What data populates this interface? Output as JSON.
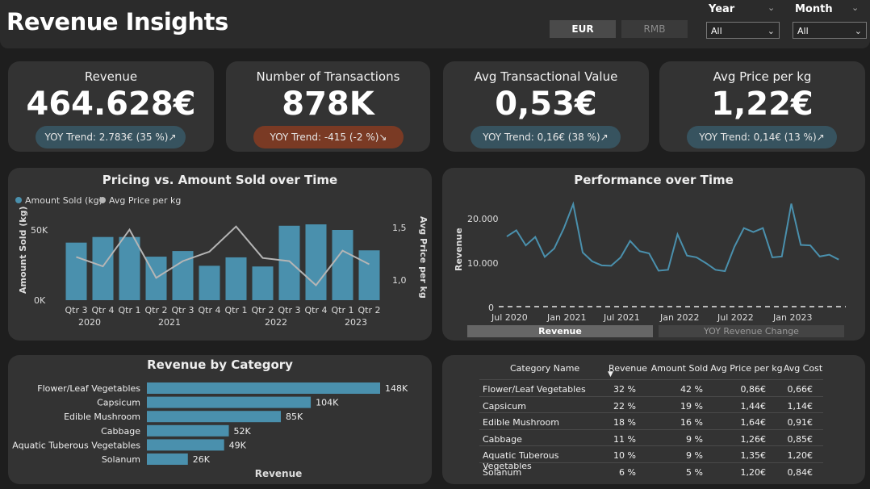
{
  "header": {
    "title": "Revenue Insights",
    "currency": {
      "eur": "EUR",
      "rmb": "RMB"
    },
    "year": {
      "label": "Year",
      "value": "All"
    },
    "month": {
      "label": "Month",
      "value": "All"
    }
  },
  "kpis": [
    {
      "title": "Revenue",
      "value": "464.628€",
      "trend": "YOY Trend: 2.783€ (35 %)↗",
      "direction": "up"
    },
    {
      "title": "Number of Transactions",
      "value": "878K",
      "trend": "YOY Trend: -415 (-2 %)↘",
      "direction": "down"
    },
    {
      "title": "Avg Transactional Value",
      "value": "0,53€",
      "trend": "YOY Trend: 0,16€ (38 %)↗",
      "direction": "up"
    },
    {
      "title": "Avg Price per kg",
      "value": "1,22€",
      "trend": "YOY Trend: 0,14€ (13 %)↗",
      "direction": "up"
    }
  ],
  "colors": {
    "accent": "#4a90ad",
    "line_gray": "#b5b5b5",
    "panel": "#333333",
    "background": "#1e1e1e"
  },
  "pricing_chart": {
    "title": "Pricing vs. Amount Sold over Time",
    "legend": [
      "Amount Sold (kg)",
      "Avg Price per kg"
    ],
    "ylabel_left": "Amount Sold (kg)",
    "ylabel_right": "Avg Price per kg",
    "left_ticks": [
      "50K",
      "0K"
    ],
    "right_ticks": [
      "1,5",
      "1,0"
    ],
    "quarters": [
      "Qtr 3",
      "Qtr 4",
      "Qtr 1",
      "Qtr 2",
      "Qtr 3",
      "Qtr 4",
      "Qtr 1",
      "Qtr 2",
      "Qtr 3",
      "Qtr 4",
      "Qtr 1",
      "Qtr 2"
    ],
    "years": [
      "2020",
      "2021",
      "2022",
      "2023"
    ]
  },
  "performance_chart": {
    "title": "Performance over Time",
    "ylabel": "Revenue",
    "y_ticks": [
      "20.000",
      "10.000",
      "0"
    ],
    "x_ticks": [
      "Jul 2020",
      "Jan 2021",
      "Jul 2021",
      "Jan 2022",
      "Jul 2022",
      "Jan 2023"
    ],
    "tab_active": "Revenue",
    "tab_inactive": "YOY Revenue Change"
  },
  "category_chart": {
    "title": "Revenue by Category",
    "xlabel": "Revenue",
    "value_labels": [
      "148K",
      "104K",
      "85K",
      "52K",
      "49K",
      "26K"
    ]
  },
  "table": {
    "headers": [
      "Category Name",
      "Revenue",
      "Amount Sold",
      "Avg Price per kg",
      "Avg Cost"
    ],
    "rows": [
      [
        "Flower/Leaf Vegetables",
        "32 %",
        "42 %",
        "0,86€",
        "0,66€"
      ],
      [
        "Capsicum",
        "22 %",
        "19 %",
        "1,44€",
        "1,14€"
      ],
      [
        "Edible Mushroom",
        "18 %",
        "16 %",
        "1,64€",
        "0,91€"
      ],
      [
        "Cabbage",
        "11 %",
        "9 %",
        "1,26€",
        "0,85€"
      ],
      [
        "Aquatic Tuberous Vegetables",
        "10 %",
        "9 %",
        "1,35€",
        "1,20€"
      ],
      [
        "Solanum",
        "6 %",
        "5 %",
        "1,20€",
        "0,84€"
      ]
    ]
  },
  "chart_data": [
    {
      "type": "bar",
      "title": "Pricing vs. Amount Sold over Time",
      "categories": [
        "2020 Qtr 3",
        "2020 Qtr 4",
        "2021 Qtr 1",
        "2021 Qtr 2",
        "2021 Qtr 3",
        "2021 Qtr 4",
        "2022 Qtr 1",
        "2022 Qtr 2",
        "2022 Qtr 3",
        "2022 Qtr 4",
        "2023 Qtr 1",
        "2023 Qtr 2"
      ],
      "series": [
        {
          "name": "Amount Sold (kg)",
          "type": "bar",
          "axis": "left",
          "values": [
            41000,
            45000,
            45000,
            31000,
            35000,
            24500,
            30500,
            24000,
            53000,
            54000,
            50000,
            35500
          ]
        },
        {
          "name": "Avg Price per kg",
          "type": "line",
          "axis": "right",
          "values": [
            1.22,
            1.13,
            1.48,
            1.02,
            1.18,
            1.27,
            1.51,
            1.21,
            1.18,
            0.95,
            1.28,
            1.15
          ]
        }
      ],
      "ylabel": "Amount Sold (kg)",
      "y2label": "Avg Price per kg",
      "ylim": [
        0,
        60000
      ],
      "y2lim": [
        0.8,
        1.7
      ],
      "legend": "top-left"
    },
    {
      "type": "line",
      "title": "Performance over Time",
      "x": [
        "2020-07",
        "2020-08",
        "2020-09",
        "2020-10",
        "2020-11",
        "2020-12",
        "2021-01",
        "2021-02",
        "2021-03",
        "2021-04",
        "2021-05",
        "2021-06",
        "2021-07",
        "2021-08",
        "2021-09",
        "2021-10",
        "2021-11",
        "2021-12",
        "2022-01",
        "2022-02",
        "2022-03",
        "2022-04",
        "2022-05",
        "2022-06",
        "2022-07",
        "2022-08",
        "2022-09",
        "2022-10",
        "2022-11",
        "2022-12",
        "2023-01",
        "2023-02",
        "2023-03",
        "2023-04",
        "2023-05",
        "2023-06"
      ],
      "series": [
        {
          "name": "Revenue",
          "values": [
            15800,
            17200,
            13800,
            15700,
            11200,
            13100,
            17600,
            23100,
            12200,
            10200,
            9300,
            9200,
            11100,
            14800,
            12500,
            12000,
            8100,
            8300,
            16300,
            11500,
            11100,
            9800,
            8300,
            8000,
            13500,
            17700,
            16800,
            17700,
            11100,
            11300,
            23200,
            13900,
            13800,
            11300,
            11700,
            10600
          ]
        }
      ],
      "ylabel": "Revenue",
      "ylim": [
        0,
        25000
      ]
    },
    {
      "type": "bar",
      "orientation": "horizontal",
      "title": "Revenue by Category",
      "categories": [
        "Flower/Leaf Vegetables",
        "Capsicum",
        "Edible Mushroom",
        "Cabbage",
        "Aquatic Tuberous Vegetables",
        "Solanum"
      ],
      "values": [
        148000,
        104000,
        85000,
        52000,
        49000,
        26000
      ],
      "xlabel": "Revenue"
    }
  ]
}
